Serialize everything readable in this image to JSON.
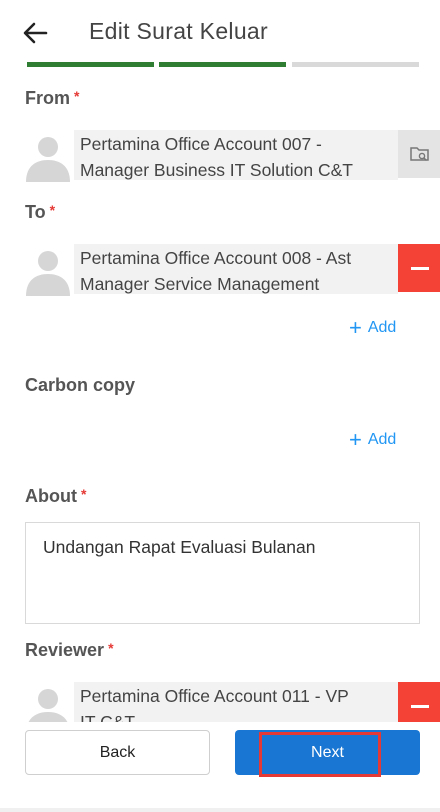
{
  "header": {
    "title": "Edit Surat Keluar"
  },
  "colors": {
    "step_active": "#2e7d32",
    "step_inactive": "#d9d9d9",
    "primary": "#1976d2",
    "danger": "#f44336",
    "link": "#2196f3",
    "highlight": "#e53935"
  },
  "progress": {
    "total_steps": 3,
    "completed_steps": 2
  },
  "from": {
    "label": "From",
    "required": "*",
    "person": {
      "line1": "Pertamina Office Account 007 -",
      "line2": "Manager Business IT Solution C&T",
      "action_icon": "folder-search-icon"
    }
  },
  "to": {
    "label": "To",
    "required": "*",
    "person": {
      "line1": "Pertamina Office Account 008 - Ast",
      "line2": "Manager Service Management",
      "action_icon": "minus-icon"
    },
    "add_label": "Add"
  },
  "cc": {
    "label": "Carbon copy",
    "add_label": "Add"
  },
  "about": {
    "label": "About",
    "required": "*",
    "value": "Undangan Rapat Evaluasi Bulanan"
  },
  "reviewer": {
    "label": "Reviewer",
    "required": "*",
    "person": {
      "line1": "Pertamina Office Account 011 - VP",
      "line2": "IT C&T",
      "action_icon": "minus-icon"
    }
  },
  "footer": {
    "back_label": "Back",
    "next_label": "Next"
  }
}
